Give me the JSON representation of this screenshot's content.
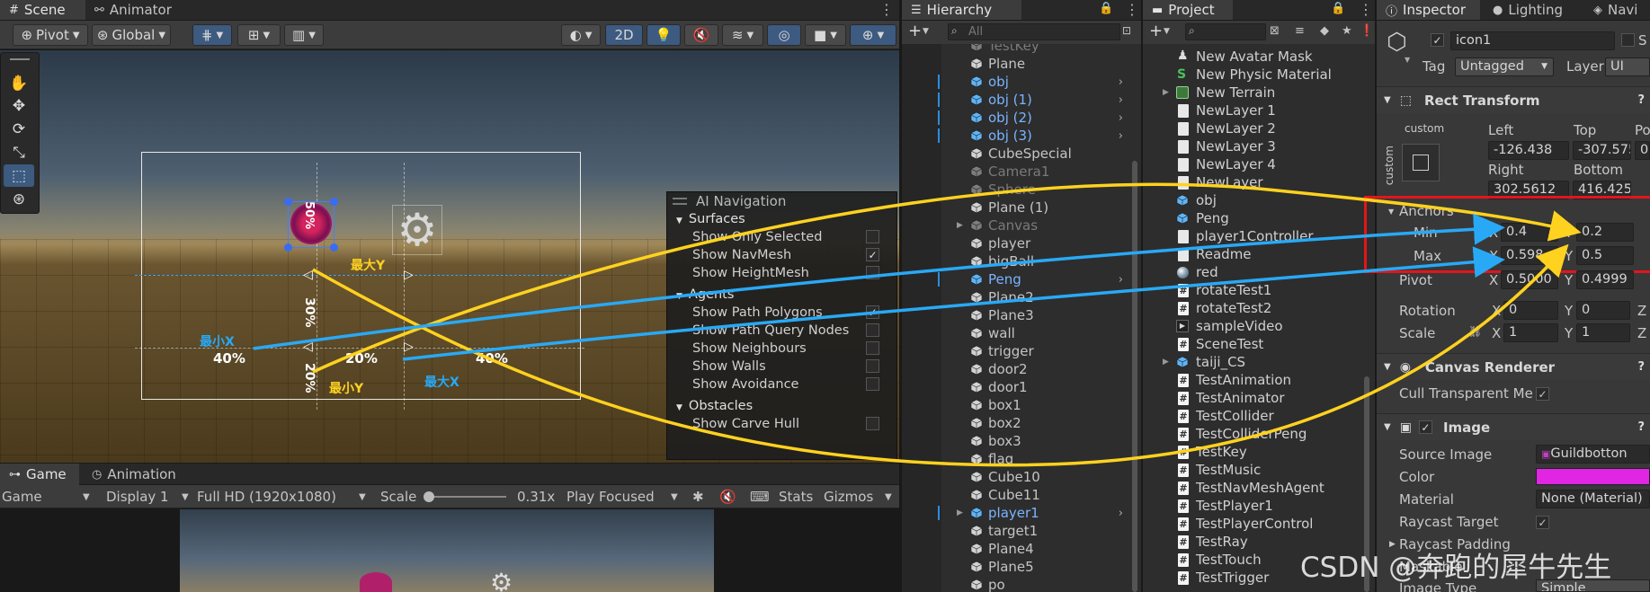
{
  "scene": {
    "tabs": [
      {
        "label": "Scene"
      },
      {
        "label": "Animator"
      }
    ],
    "toolbar": {
      "pivot": "Pivot",
      "global": "Global",
      "mode2d": "2D"
    },
    "labels": {
      "max_y": "最大Y",
      "min_x": "最小X",
      "min_y": "最小Y",
      "max_x": "最大X",
      "pct_50": "50%",
      "pct_30": "30%",
      "pct_20a": "20%",
      "pct_20b": "20%",
      "pct_40a": "40%",
      "pct_40b": "40%"
    }
  },
  "ai_navigation": {
    "title": "AI Navigation",
    "sections": [
      {
        "label": "Surfaces",
        "items": [
          {
            "label": "Show Only Selected",
            "checked": false
          },
          {
            "label": "Show NavMesh",
            "checked": true
          },
          {
            "label": "Show HeightMesh",
            "checked": false
          }
        ]
      },
      {
        "label": "Agents",
        "items": [
          {
            "label": "Show Path Polygons",
            "checked": true
          },
          {
            "label": "Show Path Query Nodes",
            "checked": false
          },
          {
            "label": "Show Neighbours",
            "checked": false
          },
          {
            "label": "Show Walls",
            "checked": false
          },
          {
            "label": "Show Avoidance",
            "checked": false
          }
        ]
      },
      {
        "label": "Obstacles",
        "items": [
          {
            "label": "Show Carve Hull",
            "checked": false
          }
        ]
      }
    ]
  },
  "game": {
    "tabs": [
      {
        "label": "Game"
      },
      {
        "label": "Animation"
      }
    ],
    "toolbar": {
      "view": "Game",
      "display": "Display 1",
      "resolution": "Full HD (1920x1080)",
      "scale_label": "Scale",
      "scale_value": "0.31x",
      "play_mode": "Play Focused",
      "stats": "Stats",
      "gizmos": "Gizmos"
    }
  },
  "hierarchy": {
    "title": "Hierarchy",
    "search_placeholder": "All",
    "items": [
      {
        "label": "TestKey",
        "style": "gray"
      },
      {
        "label": "Plane",
        "style": "normal"
      },
      {
        "label": "obj",
        "style": "prefab",
        "expand": true
      },
      {
        "label": "obj (1)",
        "style": "prefab",
        "expand": true
      },
      {
        "label": "obj (2)",
        "style": "prefab",
        "expand": true
      },
      {
        "label": "obj (3)",
        "style": "prefab",
        "expand": true
      },
      {
        "label": "CubeSpecial",
        "style": "normal"
      },
      {
        "label": "Camera1",
        "style": "gray"
      },
      {
        "label": "Sphere",
        "style": "gray"
      },
      {
        "label": "Plane (1)",
        "style": "normal"
      },
      {
        "label": "Canvas",
        "style": "gray",
        "fold": true
      },
      {
        "label": "player",
        "style": "normal"
      },
      {
        "label": "bigBall",
        "style": "normal"
      },
      {
        "label": "Peng",
        "style": "prefab",
        "expand": true
      },
      {
        "label": "Plane2",
        "style": "normal"
      },
      {
        "label": "Plane3",
        "style": "normal"
      },
      {
        "label": "wall",
        "style": "normal"
      },
      {
        "label": "trigger",
        "style": "normal"
      },
      {
        "label": "door2",
        "style": "normal"
      },
      {
        "label": "door1",
        "style": "normal"
      },
      {
        "label": "box1",
        "style": "normal"
      },
      {
        "label": "box2",
        "style": "normal"
      },
      {
        "label": "box3",
        "style": "normal"
      },
      {
        "label": "flag",
        "style": "normal"
      },
      {
        "label": "Cube10",
        "style": "normal"
      },
      {
        "label": "Cube11",
        "style": "normal"
      },
      {
        "label": "player1",
        "style": "prefab",
        "expand": true,
        "fold": true
      },
      {
        "label": "target1",
        "style": "normal"
      },
      {
        "label": "Plane4",
        "style": "normal"
      },
      {
        "label": "Plane5",
        "style": "normal"
      },
      {
        "label": "po",
        "style": "normal"
      }
    ]
  },
  "project": {
    "title": "Project",
    "items": [
      {
        "label": "New Avatar Mask",
        "icon": "avatar"
      },
      {
        "label": "New Physic Material",
        "icon": "physic"
      },
      {
        "label": "New Terrain",
        "icon": "terrain",
        "fold": true
      },
      {
        "label": "NewLayer 1",
        "icon": "file"
      },
      {
        "label": "NewLayer 2",
        "icon": "file"
      },
      {
        "label": "NewLayer 3",
        "icon": "file"
      },
      {
        "label": "NewLayer 4",
        "icon": "file"
      },
      {
        "label": "NewLayer",
        "icon": "file"
      },
      {
        "label": "obj",
        "icon": "prefab"
      },
      {
        "label": "Peng",
        "icon": "prefab"
      },
      {
        "label": "player1Controller",
        "icon": "file"
      },
      {
        "label": "Readme",
        "icon": "file"
      },
      {
        "label": "red",
        "icon": "material"
      },
      {
        "label": "rotateTest1",
        "icon": "hash"
      },
      {
        "label": "rotateTest2",
        "icon": "hash"
      },
      {
        "label": "sampleVideo",
        "icon": "video"
      },
      {
        "label": "SceneTest",
        "icon": "hash"
      },
      {
        "label": "taiji_CS",
        "icon": "prefab",
        "fold": true
      },
      {
        "label": "TestAnimation",
        "icon": "hash"
      },
      {
        "label": "TestAnimator",
        "icon": "hash"
      },
      {
        "label": "TestCollider",
        "icon": "hash"
      },
      {
        "label": "TestColliderPeng",
        "icon": "hash"
      },
      {
        "label": "TestKey",
        "icon": "hash"
      },
      {
        "label": "TestMusic",
        "icon": "hash"
      },
      {
        "label": "TestNavMeshAgent",
        "icon": "hash"
      },
      {
        "label": "TestPlayer1",
        "icon": "hash"
      },
      {
        "label": "TestPlayerControl",
        "icon": "hash"
      },
      {
        "label": "TestRay",
        "icon": "hash"
      },
      {
        "label": "TestTouch",
        "icon": "hash"
      },
      {
        "label": "TestTrigger",
        "icon": "hash"
      }
    ]
  },
  "inspector": {
    "tabs": [
      {
        "label": "Inspector"
      },
      {
        "label": "Lighting"
      },
      {
        "label": "Navi"
      }
    ],
    "object_name": "icon1",
    "static_label": "S",
    "tag_label": "Tag",
    "tag_value": "Untagged",
    "layer_label": "Layer",
    "layer_value": "UI",
    "rect_transform": {
      "title": "Rect Transform",
      "custom_top": "custom",
      "custom_side": "custom",
      "left_label": "Left",
      "top_label": "Top",
      "pos_label": "Po",
      "left": "-126.438",
      "top": "-307.575",
      "pos": "0",
      "right_label": "Right",
      "bottom_label": "Bottom",
      "right": "302.5612",
      "bottom": "416.4252",
      "anchors_label": "Anchors",
      "min_label": "Min",
      "max_label": "Max",
      "min_x": "0.4",
      "min_y": "0.2",
      "max_x": "0.598",
      "max_y": "0.5",
      "pivot_label": "Pivot",
      "pivot_x": "0.5000",
      "pivot_y": "0.4999",
      "rotation_label": "Rotation",
      "rot_x": "0",
      "rot_y": "0",
      "rot_z": "Z",
      "scale_label": "Scale",
      "scale_x": "1",
      "scale_y": "1",
      "scale_z": "Z",
      "x": "X",
      "y": "Y"
    },
    "canvas_renderer": {
      "title": "Canvas Renderer",
      "cull_label": "Cull Transparent Me"
    },
    "image": {
      "title": "Image",
      "source_label": "Source Image",
      "source_value": "Guildbotton",
      "color_label": "Color",
      "color_value": "#e026e3",
      "material_label": "Material",
      "material_value": "None (Material)",
      "raycast_label": "Raycast Target",
      "padding_label": "Raycast Padding",
      "maskable_label": "Maskable",
      "image_type_label": "Image Type",
      "image_type_value": "Simple"
    }
  },
  "watermark": "CSDN @奔跑的犀牛先生",
  "colors": {
    "annotation_yellow": "#ffd21f",
    "annotation_blue": "#29a9f5",
    "highlight_red": "#e3151b",
    "selection": "#2c5d87"
  }
}
